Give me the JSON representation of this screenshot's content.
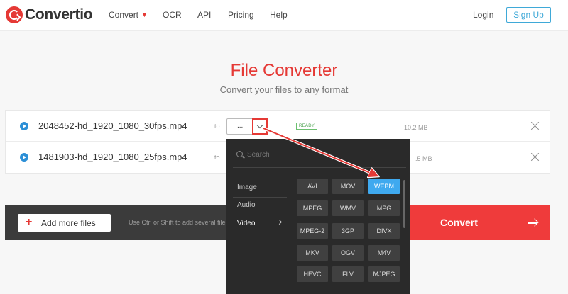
{
  "brand": {
    "name": "Convertio",
    "accent": "#e53935"
  },
  "nav": {
    "convert": "Convert",
    "ocr": "OCR",
    "api": "API",
    "pricing": "Pricing",
    "help": "Help",
    "login": "Login",
    "signup": "Sign Up"
  },
  "hero": {
    "title": "File Converter",
    "subtitle": "Convert your files to any format"
  },
  "files": [
    {
      "name": "2048452-hd_1920_1080_30fps.mp4",
      "to": "to",
      "format": "...",
      "status": "READY",
      "size": "10.2 MB"
    },
    {
      "name": "1481903-hd_1920_1080_25fps.mp4",
      "to": "to",
      "size": ".5 MB"
    }
  ],
  "actions": {
    "add_files": "Add more files",
    "hint": "Use Ctrl or Shift to add several file",
    "convert": "Convert"
  },
  "dropdown": {
    "search_placeholder": "Search",
    "categories": [
      "Image",
      "Audio",
      "Video"
    ],
    "selected_category": "Video",
    "formats": [
      "AVI",
      "MOV",
      "WEBM",
      "MPEG",
      "WMV",
      "MPG",
      "MPEG-2",
      "3GP",
      "DIVX",
      "MKV",
      "OGV",
      "M4V",
      "HEVC",
      "FLV",
      "MJPEG"
    ],
    "highlighted_format": "WEBM",
    "highlight_color": "#3fa9ef"
  }
}
